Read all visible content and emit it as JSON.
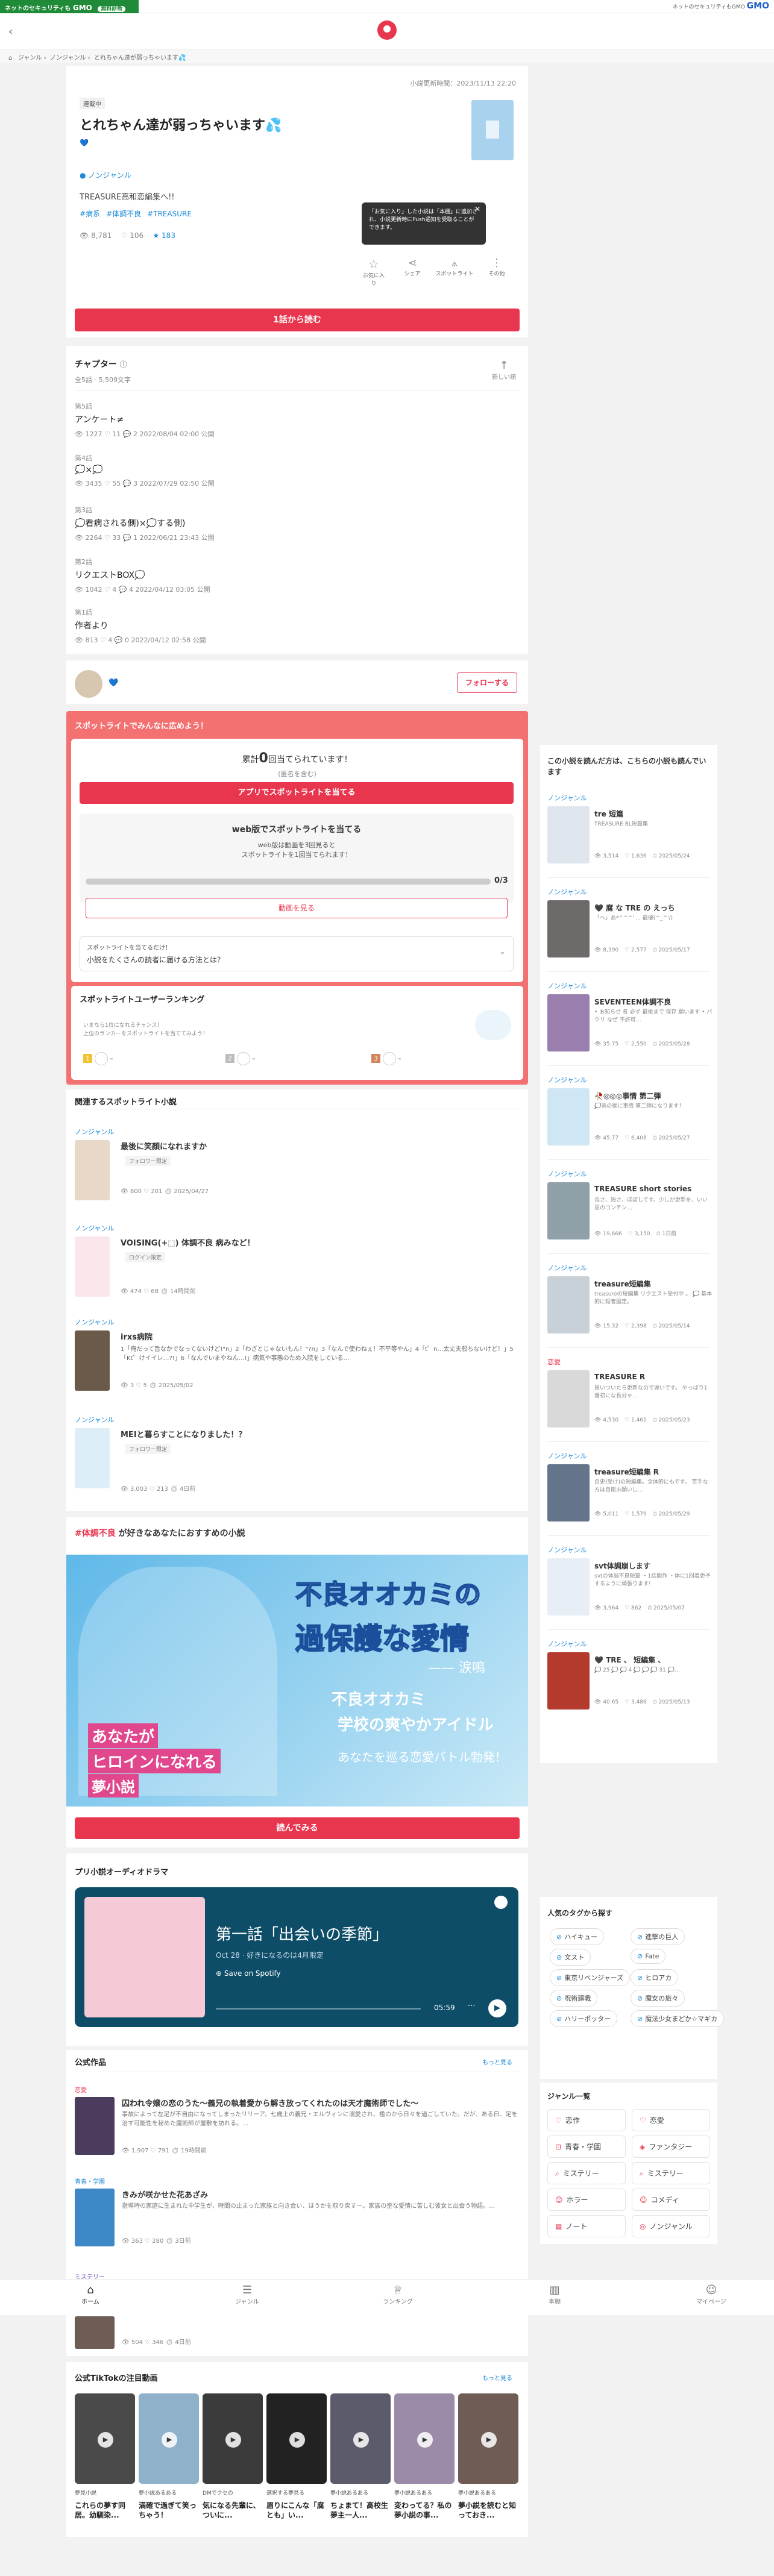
{
  "ad": {
    "left_text": "ネットのセキュリティも",
    "brand": "GMO",
    "badge": "無料診断",
    "right_text": "ネットのセキュリティもGMO",
    "right_brand": "GMO"
  },
  "breadcrumb": [
    "ジャンル",
    "ノンジャンル",
    "とれちゃん達が弱っちゃいます💦"
  ],
  "novel": {
    "updated": "小説更新時間：2023/11/13 22:20",
    "badge": "連載中",
    "title": "とれちゃん達が弱っちゃいます💦",
    "author_line": "💙",
    "genre": "ノンジャンル",
    "summary": "TREASURE高和恋編集へ!!",
    "tags": [
      "#病系",
      "#体調不良",
      "#TREASURE"
    ],
    "views": "8,781",
    "likes": "106",
    "stars": "183",
    "tooltip": "「お気に入り」した小説は「本棚」に追加され、小説更新時にPush通知を受取ることができます。",
    "actions": [
      "お気に入り",
      "シェア",
      "スポットライト",
      "その他"
    ],
    "read_button": "1話から読む"
  },
  "chapters": {
    "title": "チャプター",
    "info": "全5話 · 5,509文字",
    "sort_label": "新しい順",
    "items": [
      {
        "num": "第5話",
        "title": "アンケート≠",
        "meta": "👁 1227  ♡ 11  💬 2  2022/08/04 02:00 公開"
      },
      {
        "num": "第4話",
        "title": "💭×💭",
        "meta": "👁 3435  ♡ 55  💬 3  2022/07/29 02:50 公開"
      },
      {
        "num": "第3話",
        "title": "💭看病される側)×💭する側)",
        "meta": "👁 2264  ♡ 33  💬 1  2022/06/21 23:43 公開"
      },
      {
        "num": "第2話",
        "title": "リクエストBOX💭",
        "meta": "👁 1042  ♡ 4  💬 4  2022/04/12 03:05 公開"
      },
      {
        "num": "第1話",
        "title": "作者より",
        "meta": "👁 813  ♡ 4  💬 0  2022/04/12 02:58 公開"
      }
    ]
  },
  "author": {
    "name": "💙",
    "follow": "フォローする"
  },
  "spotlight": {
    "header": "スポットライトでみんなに広めよう！",
    "count_prefix": "累計",
    "count": "0",
    "count_suffix": "回当てられています！",
    "count_sub": "(匿名を含む)",
    "app_button": "アプリでスポットライトを当てる",
    "web_title": "web版でスポットライトを当てる",
    "web_desc1": "web版は動画を3回見ると",
    "web_desc2": "スポットライトを1回当てられます！",
    "progress_label": "0/3",
    "progress_value": 0,
    "video_button": "動画を見る",
    "faq_q1": "スポットライトを当てるだけ！",
    "faq_q2": "小説をたくさんの読者に届ける方法とは？",
    "ranking_title": "スポットライトユーザーランキング",
    "ranking_sub1": "いまなら1位になれるチャンス！",
    "ranking_sub2": "上位のランカーをスポットライトを当ててみよう！",
    "ranks": [
      "1",
      "2",
      "3"
    ],
    "rank_dash": "–"
  },
  "related": {
    "title": "関連するスポットライト小説",
    "items": [
      {
        "cat": "ノンジャンル",
        "title": "最後に笑顔になれますか",
        "badge": "フォロワー限定",
        "desc": "",
        "meta": "👁 800  ♡ 201  ⏱ 2025/04/27"
      },
      {
        "cat": "ノンジャンル",
        "title": "VOISING(+⬚) 体調不良 病みなど！",
        "badge": "ログイン限定",
        "desc": "",
        "meta": "👁 474  ♡ 68  ⏱ 14時間前"
      },
      {
        "cat": "ノンジャンル",
        "title": "irxs病院",
        "badge": "",
        "desc": "1「俺だって旨なかでなってないけど!\"n」2「わざとじゃないもん！\"?n」3「なんで使わねぇ！不平等やん」4「t゛n…太丈夫般ちないけど！」5「Kt゛けイイレ…?!」6「なんでいまやねん…!」病気や事態のため入院をしている…",
        "meta": "👁 3  ♡ 5  ⏱ 2025/05/02"
      },
      {
        "cat": "ノンジャンル",
        "title": "MEIと暮らすことになりました！？",
        "badge": "フォロワー限定",
        "desc": "",
        "meta": "👁 3,003  ♡ 213  ⏱ 4日前"
      }
    ]
  },
  "recommend": {
    "hashtag": "#体調不良",
    "title_suffix": "が好きなあなたにおすすめの小説",
    "banner_line1": "不良オオカミの",
    "banner_line2": "過保護な愛情",
    "banner_author": "—— 涙鳴",
    "banner_sub1": "不良オオカミ",
    "banner_sub2": "学校の爽やかアイドル",
    "banner_sub3": "あなたを巡る恋愛バトル勃発！",
    "banner_heroine1": "あなたが",
    "banner_heroine2": "ヒロインになれる",
    "banner_heroine3": "夢小説",
    "read_button": "読んでみる"
  },
  "audio": {
    "title": "プリ小説オーディオドラマ",
    "episode": "第一話「出会いの季節」",
    "meta": "Oct 28 · 好きになるのは4月限定",
    "save": "Save on Spotify",
    "time": "05:59"
  },
  "official": {
    "title": "公式作品",
    "more": "もっと見る",
    "items": [
      {
        "cat": "恋愛",
        "title": "囚われ令嬢の恋のうた～義兄の執着愛から解き放ってくれたのは天才魔術師でした～",
        "desc": "事故によって左足が不自由になってしまったリリーア。七歳上の義兄・エルヴィンに溺愛され、檻のから日々を過ごしていた。だが、ある日、足を治す可能性を秘めた魔術師が屋敷を訪れる。…",
        "meta": "👁 1,907  ♡ 791  ⏱ 19時間前"
      },
      {
        "cat": "青春・学園",
        "title": "きみが咲かせた花あざみ",
        "desc": "指導時の家庭に生まれた中学生が、時間の止まった家族と向き合い、ほうかを取り戻すー。家族の歪な愛情に苦しむ彼女と出会う物語。…",
        "meta": "👁 363  ♡ 280  ⏱ 3日前"
      },
      {
        "cat": "ミステリー",
        "title": "",
        "desc": "",
        "meta": "👁 504  ♡ 346  ⏱ 4日前"
      }
    ]
  },
  "tiktok": {
    "title": "公式TikTokの注目動画",
    "more": "もっと見る",
    "videos": [
      {
        "cat": "夢見小説",
        "title": "これらの夢す同居。幼馴染..."
      },
      {
        "cat": "夢小説あるある",
        "title": "満確で過ぎて笑っちゃう！"
      },
      {
        "cat": "DMでクセの",
        "title": "気になる先輩に、ついに..."
      },
      {
        "cat": "選択する夢見る",
        "title": "眉りにこんな「腐とも」い..."
      },
      {
        "cat": "夢小説あるある",
        "title": "ちょまて！高校生夢主一人..."
      },
      {
        "cat": "夢小説あるある",
        "title": "変わってる？私の夢小説の事..."
      },
      {
        "cat": "夢小説あるある",
        "title": "夢小説を読むと知っておき..."
      }
    ]
  },
  "sidebar": {
    "title": "この小説を読んだ方は、こちらの小説も読んでいます",
    "items": [
      {
        "cat": "ノンジャンル",
        "title": "tre 短篇",
        "desc": "TREASURE BL短篇集",
        "views": "3,514",
        "likes": "1,636",
        "date": "2025/05/24"
      },
      {
        "cat": "ノンジャンル",
        "title": "🖤 腐 な TRE の えっち",
        "desc": "「ヘ」あ*^^^' ... 最優(^_^'/)",
        "views": "8,390",
        "likes": "2,577",
        "date": "2025/05/17"
      },
      {
        "cat": "ノンジャンル",
        "title": "SEVENTEEN体調不良",
        "desc": "• お知らせ 各 必ず 最後まで 保存 願います • バクリ なぜ 不許可…",
        "views": "35.75",
        "likes": "2,550",
        "date": "2025/05/28"
      },
      {
        "cat": "ノンジャンル",
        "title": "🥀◎◎◎事情 第二弾",
        "desc": "💭逃の後に事情 第二弾になります！",
        "views": "45.77",
        "likes": "6,408",
        "date": "2025/05/27"
      },
      {
        "cat": "ノンジャンル",
        "title": "TREASURE short stories",
        "desc": "長さ、短さ、ほぼしてす。少しが更新を、いい思のコンテン…",
        "views": "19,666",
        "likes": "3,150",
        "date": "1日前"
      },
      {
        "cat": "ノンジャンル",
        "title": "treasure短編集",
        "desc": "treasureの短編集 リクエスト受付中 。 💭 基本的に短者固定。",
        "views": "15.32",
        "likes": "2,398",
        "date": "2025/05/14"
      },
      {
        "cat": "恋愛",
        "title": "TREASURE R",
        "desc": "思いついたら更新なので遅いです。 やっぱり1番初にな長分ゃ…",
        "views": "4,530",
        "likes": "1,461",
        "date": "2025/05/23"
      },
      {
        "cat": "ノンジャンル",
        "title": "treasure短編集 R",
        "desc": "自史(受け)の短編集。全体的にもです。 苦手な方は自衛お願いし…",
        "views": "5,011",
        "likes": "1,579",
        "date": "2025/05/29"
      },
      {
        "cat": "ノンジャンル",
        "title": "svt体調崩します",
        "desc": "svtの体調不良短篇 ・1話間作 ・体に1回着更予するように頑張ります!",
        "views": "3,964",
        "likes": "862",
        "date": "2025/05/07"
      },
      {
        "cat": "ノンジャンル",
        "title": "🖤 TRE 、 短編集 、",
        "desc": "💭 25 💭 💭 4 💭 💭 💭 31 💭…",
        "views": "40.65",
        "likes": "3,486",
        "date": "2025/05/13"
      }
    ]
  },
  "popular_tags": {
    "title": "人気のタグから探す",
    "tags": [
      "ハイキュー",
      "進撃の巨人",
      "文スト",
      "Fate",
      "東京リベンジャーズ",
      "ヒロアカ",
      "呪術廻戦",
      "魔女の旅々",
      "ハリーポッター",
      "魔法少女まどか☆マギカ"
    ]
  },
  "genre_list": {
    "title": "ジャンル一覧",
    "items": [
      "恋作",
      "恋愛",
      "青春・学園",
      "ファンタジー",
      "ミステリー",
      "ミステリー",
      "ホラー",
      "コメディ",
      "ノート",
      "ノンジャンル"
    ]
  },
  "bottom_nav": [
    "ホーム",
    "ジャンル",
    "ランキング",
    "本棚",
    "マイページ"
  ],
  "colors": {
    "accent": "#e8364f",
    "link": "#1b8ad8",
    "spotlight": "#f47171",
    "ad_green": "#1f8a37"
  }
}
